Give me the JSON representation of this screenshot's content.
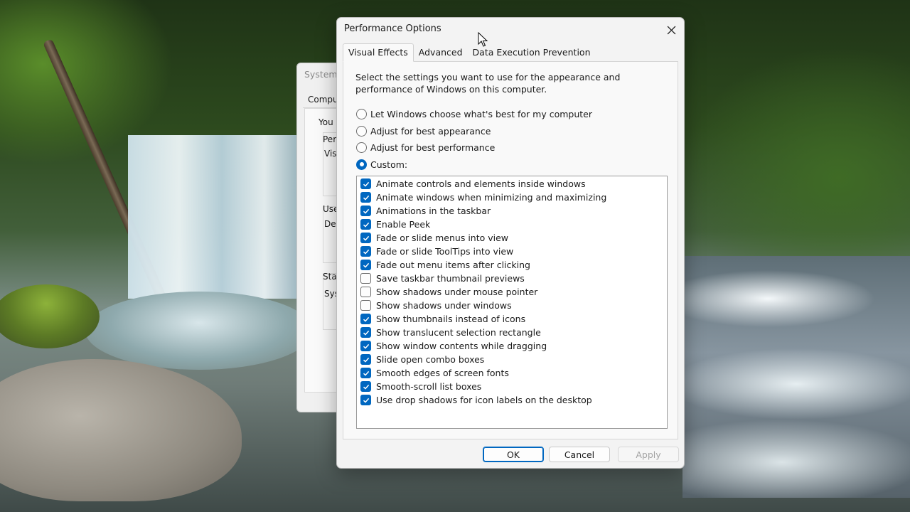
{
  "dialog": {
    "title": "Performance Options",
    "tabs": [
      {
        "label": "Visual Effects",
        "active": true
      },
      {
        "label": "Advanced",
        "active": false
      },
      {
        "label": "Data Execution Prevention",
        "active": false
      }
    ],
    "description": "Select the settings you want to use for the appearance and performance of Windows on this computer.",
    "radios": [
      {
        "label": "Let Windows choose what's best for my computer",
        "selected": false
      },
      {
        "label": "Adjust for best appearance",
        "selected": false
      },
      {
        "label": "Adjust for best performance",
        "selected": false
      },
      {
        "label": "Custom:",
        "selected": true
      }
    ],
    "effects": [
      {
        "label": "Animate controls and elements inside windows",
        "checked": true
      },
      {
        "label": "Animate windows when minimizing and maximizing",
        "checked": true
      },
      {
        "label": "Animations in the taskbar",
        "checked": true
      },
      {
        "label": "Enable Peek",
        "checked": true
      },
      {
        "label": "Fade or slide menus into view",
        "checked": true
      },
      {
        "label": "Fade or slide ToolTips into view",
        "checked": true
      },
      {
        "label": "Fade out menu items after clicking",
        "checked": true
      },
      {
        "label": "Save taskbar thumbnail previews",
        "checked": false
      },
      {
        "label": "Show shadows under mouse pointer",
        "checked": false
      },
      {
        "label": "Show shadows under windows",
        "checked": false
      },
      {
        "label": "Show thumbnails instead of icons",
        "checked": true
      },
      {
        "label": "Show translucent selection rectangle",
        "checked": true
      },
      {
        "label": "Show window contents while dragging",
        "checked": true
      },
      {
        "label": "Slide open combo boxes",
        "checked": true
      },
      {
        "label": "Smooth edges of screen fonts",
        "checked": true
      },
      {
        "label": "Smooth-scroll list boxes",
        "checked": true
      },
      {
        "label": "Use drop shadows for icon labels on the desktop",
        "checked": true
      }
    ],
    "buttons": {
      "ok": "OK",
      "cancel": "Cancel",
      "apply": "Apply"
    },
    "colors": {
      "accent": "#0067c0"
    }
  },
  "background_window": {
    "title": "System",
    "tab": "Comput",
    "text_you": "You",
    "perf_label": "Perf",
    "visual_label": "Visu",
    "user_label": "Use",
    "desk_label": "Des",
    "start_label": "Star",
    "sys_label": "Sys"
  }
}
